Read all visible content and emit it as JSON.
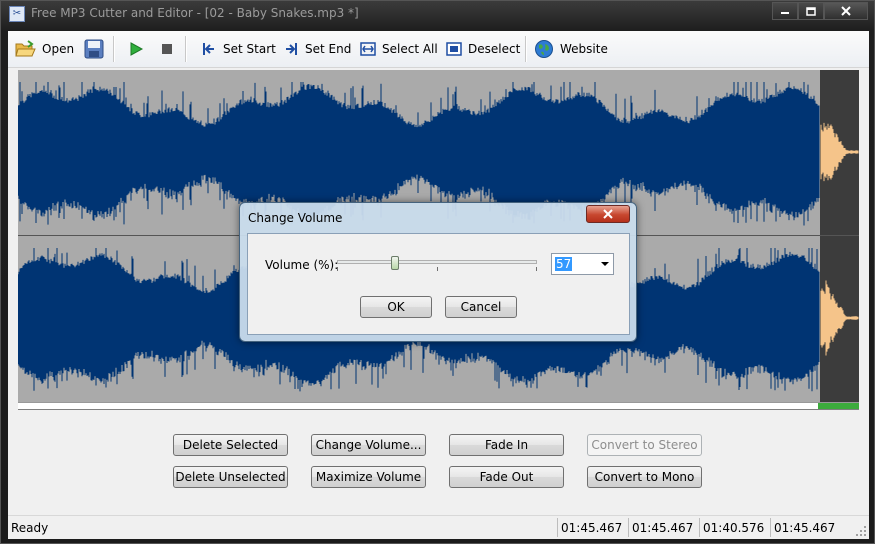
{
  "window": {
    "title": "Free MP3 Cutter and Editor - [02 - Baby Snakes.mp3 *]"
  },
  "toolbar": {
    "open": "Open",
    "set_start": "Set Start",
    "set_end": "Set End",
    "select_all": "Select All",
    "deselect": "Deselect",
    "website": "Website"
  },
  "actions": {
    "delete_selected": "Delete Selected",
    "change_volume": "Change Volume...",
    "fade_in": "Fade In",
    "convert_stereo": "Convert to Stereo",
    "delete_unselected": "Delete Unselected",
    "maximize_volume": "Maximize Volume",
    "fade_out": "Fade Out",
    "convert_mono": "Convert to Mono"
  },
  "status": {
    "text": "Ready",
    "time1": "01:45.467",
    "time2": "01:45.467",
    "time3": "01:40.576",
    "time4": "01:45.467"
  },
  "dialog": {
    "title": "Change Volume",
    "volume_label": "Volume (%):",
    "volume_value": "57",
    "volume_level_fraction": 0.29,
    "ok": "OK",
    "cancel": "Cancel"
  },
  "colors": {
    "waveform": "#003473",
    "waveform_background": "#aaaaaa",
    "selected_waveform": "#f5c48a",
    "selected_background": "#3c3c3c",
    "scroll_indicator": "#3cab3c"
  }
}
